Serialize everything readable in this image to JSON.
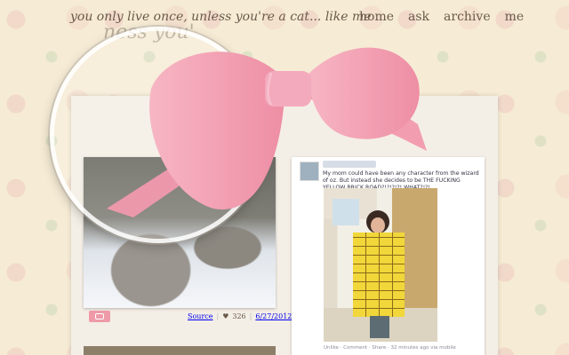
{
  "header": {
    "title": "you only live once, unless you're a cat... like me",
    "magnified_title": "ness you'"
  },
  "nav": {
    "items": [
      {
        "label": "home"
      },
      {
        "label": "ask"
      },
      {
        "label": "archive"
      },
      {
        "label": "me"
      }
    ]
  },
  "posts": [
    {
      "type": "photo",
      "icon": "camera-icon",
      "source_label": "Source",
      "heart_icon": "heart-icon",
      "notes": "326",
      "date": "6/27/2012"
    },
    {
      "type": "photo",
      "text": "My mom could have been any character from the wizard of oz. But instead she decides to be THE FUCKING YELLOW BRICK ROAD?!?!?!?! WHAT?!?!",
      "footer": "Unlike · Comment · Share · 32 minutes ago via mobile"
    }
  ],
  "colors": {
    "background": "#f6ecd6",
    "bow_pink": "#f2a1b3",
    "accent": "#ee9aa8",
    "text": "#6a5a4a"
  }
}
